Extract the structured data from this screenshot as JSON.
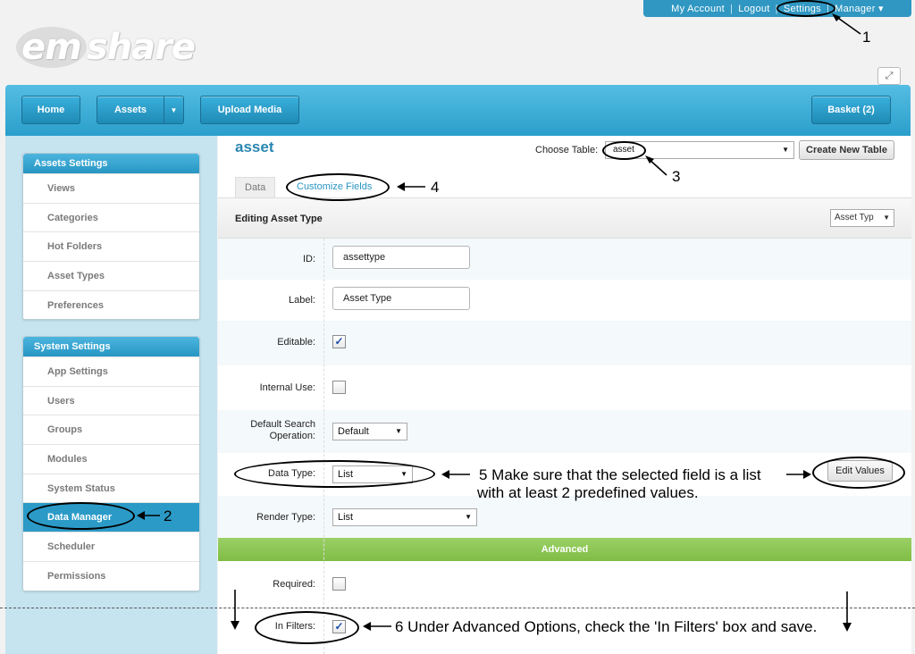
{
  "topbar": {
    "my_account": "My Account",
    "logout": "Logout",
    "settings": "Settings",
    "manager": "Manager ▾",
    "sep": "|"
  },
  "logo": {
    "em": "em",
    "rest": "share"
  },
  "navbar": {
    "home": "Home",
    "assets": "Assets",
    "upload": "Upload Media",
    "basket": "Basket (2)"
  },
  "sidebar": {
    "assets_settings": {
      "title": "Assets Settings",
      "items": [
        "Views",
        "Categories",
        "Hot Folders",
        "Asset Types",
        "Preferences"
      ]
    },
    "system_settings": {
      "title": "System Settings",
      "items": [
        "App Settings",
        "Users",
        "Groups",
        "Modules",
        "System Status",
        "Data Manager",
        "Scheduler",
        "Permissions"
      ]
    }
  },
  "main": {
    "title": "asset",
    "choose_table_label": "Choose Table:",
    "choose_table_value": "asset",
    "create_table": "Create New Table",
    "tabs": [
      "Data",
      "Customize Fields"
    ],
    "section_title": "Editing Asset Type",
    "section_select": "Asset Typ",
    "fields": {
      "id_label": "ID:",
      "id_value": "assettype",
      "label_label": "Label:",
      "label_value": "Asset Type",
      "editable_label": "Editable:",
      "internal_label": "Internal Use:",
      "default_search_label": "Default Search Operation:",
      "default_search_value": "Default",
      "data_type_label": "Data Type:",
      "data_type_value": "List",
      "render_type_label": "Render Type:",
      "render_type_value": "List",
      "required_label": "Required:",
      "in_filters_label": "In Filters:"
    },
    "edit_values": "Edit Values",
    "advanced": "Advanced"
  },
  "annotations": {
    "n1": "1",
    "n2": "2",
    "n3": "3",
    "n4": "4",
    "step5": "5  Make sure that the selected field is a list",
    "step5b": "with at least 2 predefined values.",
    "step6": "6 Under Advanced Options, check the 'In Filters' box and save."
  },
  "colors": {
    "accent": "#2a9fcb",
    "advanced": "#8ac653",
    "active_item": "#2b9ac7"
  }
}
